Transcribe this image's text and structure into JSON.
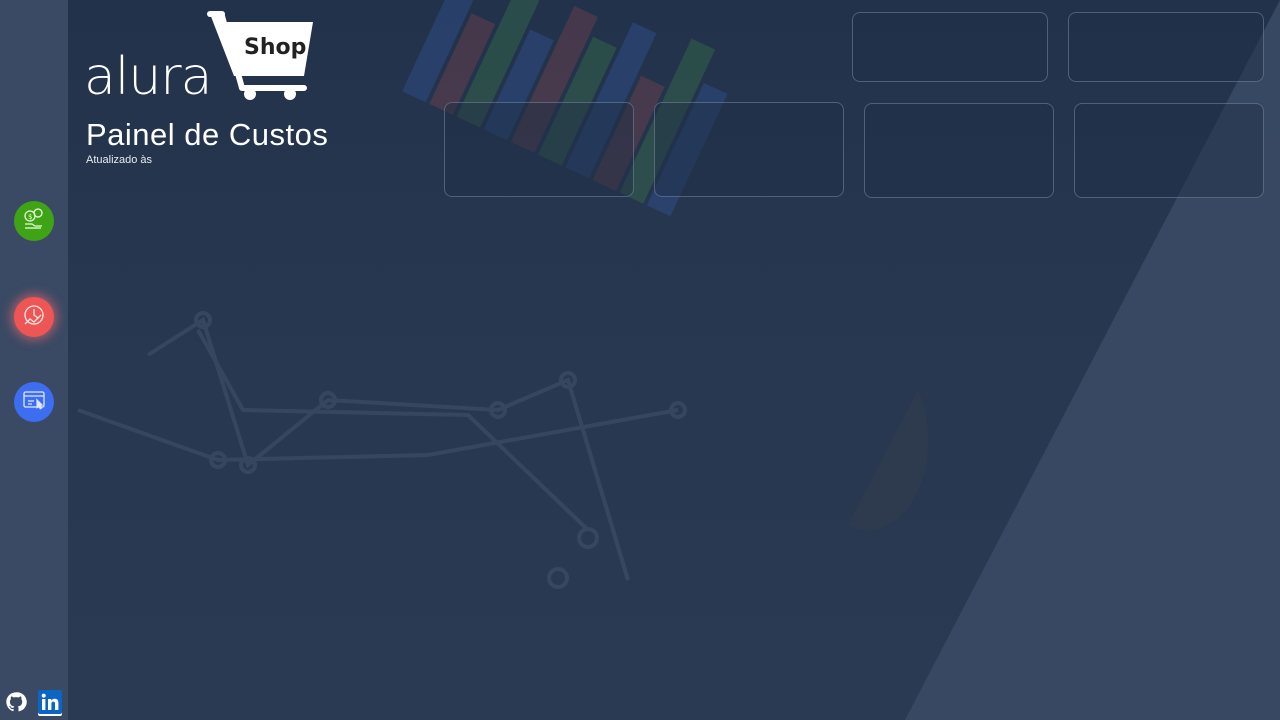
{
  "app": {
    "brand_wordmark": "alura",
    "brand_cart_label": "Shop",
    "title": "Painel de Custos",
    "updated_label": "Atualizado às"
  },
  "sidebar": {
    "items": [
      {
        "name": "custos",
        "icon": "money-exchange-icon",
        "color": "#3fa316"
      },
      {
        "name": "tempo",
        "icon": "clock-analytics-icon",
        "color": "#ee5555"
      },
      {
        "name": "web",
        "icon": "browser-click-icon",
        "color": "#3d6df0"
      }
    ],
    "social": [
      {
        "name": "github",
        "icon": "github-icon"
      },
      {
        "name": "linkedin",
        "icon": "linkedin-icon",
        "color": "#0a66c2"
      }
    ]
  },
  "cards": [
    {
      "id": "card-top-1",
      "value": ""
    },
    {
      "id": "card-top-2",
      "value": ""
    },
    {
      "id": "card-row-1",
      "value": ""
    },
    {
      "id": "card-row-2",
      "value": ""
    },
    {
      "id": "card-row-3",
      "value": ""
    },
    {
      "id": "card-row-4",
      "value": ""
    }
  ],
  "colors": {
    "background": "#2b3a52",
    "sidebar": "#3a4a64",
    "accent_green": "#3fa316",
    "accent_red": "#ee5555",
    "accent_blue": "#3d6df0"
  }
}
